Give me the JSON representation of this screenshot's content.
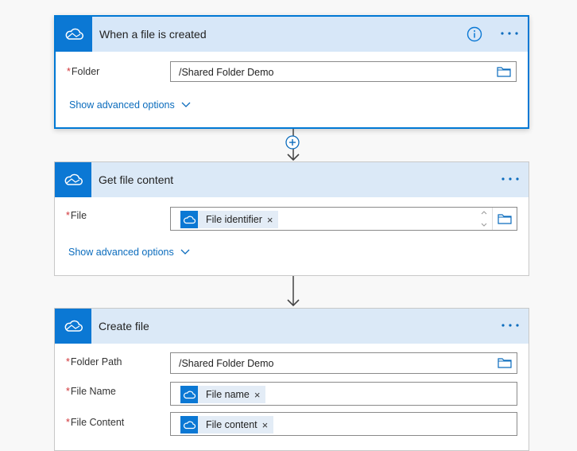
{
  "cards": [
    {
      "title": "When a file is created",
      "folder_label": "Folder",
      "folder_value": "/Shared Folder Demo",
      "advanced_label": "Show advanced options"
    },
    {
      "title": "Get file content",
      "file_label": "File",
      "file_token": "File identifier",
      "advanced_label": "Show advanced options"
    },
    {
      "title": "Create file",
      "folder_path_label": "Folder Path",
      "folder_path_value": "/Shared Folder Demo",
      "file_name_label": "File Name",
      "file_name_token": "File name",
      "file_content_label": "File Content",
      "file_content_token": "File content"
    }
  ],
  "required_marker": "*",
  "remove_glyph": "×",
  "colors": {
    "accent": "#0b78d4",
    "header": "#dbe9f7",
    "link": "#0b6cbd",
    "required": "#d13438"
  },
  "icons": [
    "onedrive-icon",
    "info-icon",
    "more-icon",
    "folder-icon",
    "chevron-down-icon",
    "add-step-icon",
    "arrow-down-icon"
  ]
}
